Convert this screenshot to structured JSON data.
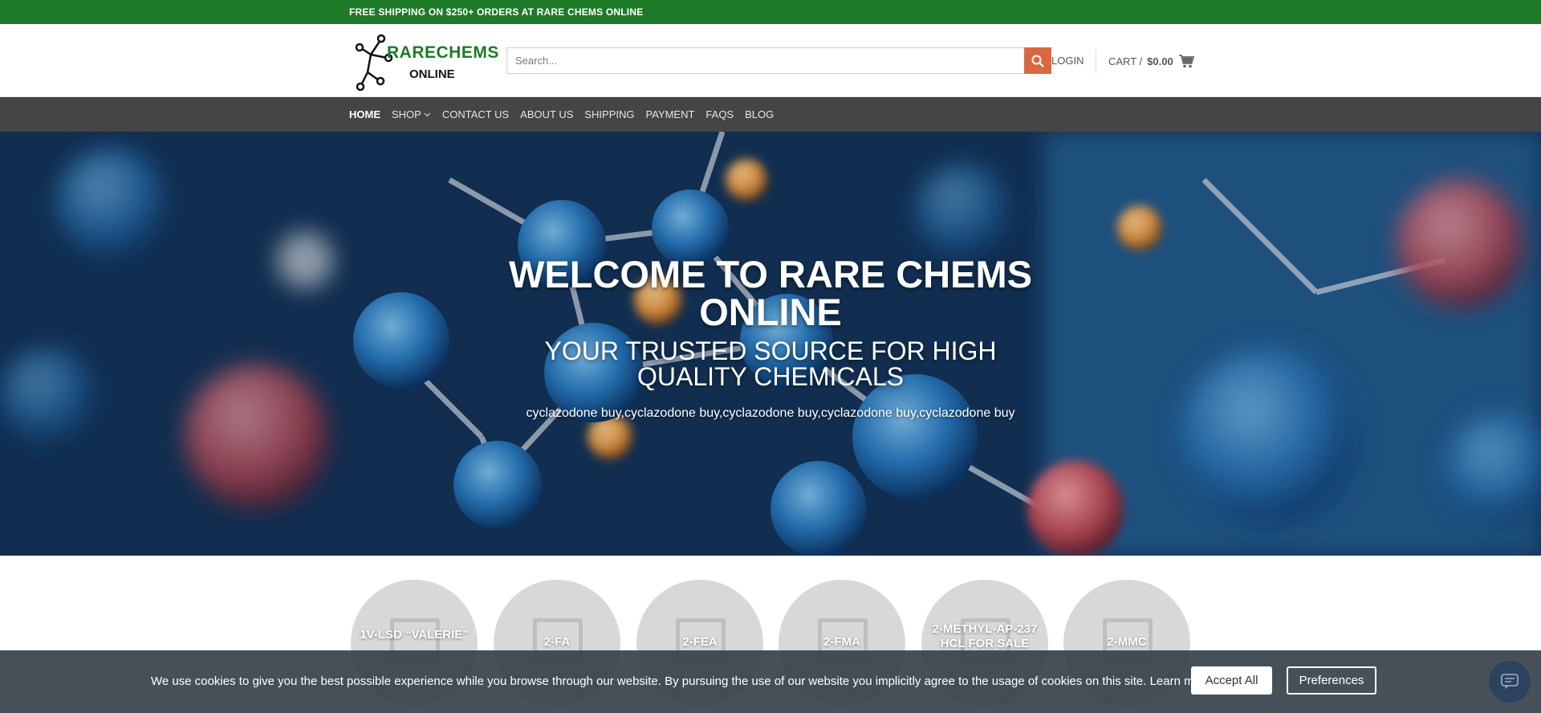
{
  "topbar": {
    "text": "FREE SHIPPING ON $250+ ORDERS AT RARE CHEMS ONLINE"
  },
  "header": {
    "logo_line1": "RARECHEMS",
    "logo_line2": "ONLINE",
    "search_placeholder": "Search...",
    "login": "LOGIN",
    "cart_label": "CART /",
    "cart_amount": "$0.00"
  },
  "nav": {
    "items": [
      {
        "label": "HOME"
      },
      {
        "label": "SHOP"
      },
      {
        "label": "CONTACT US"
      },
      {
        "label": "ABOUT US"
      },
      {
        "label": "SHIPPING"
      },
      {
        "label": "PAYMENT"
      },
      {
        "label": "FAQS"
      },
      {
        "label": "BLOG"
      }
    ]
  },
  "hero": {
    "title": "WELCOME TO  RARE CHEMS ONLINE",
    "subtitle": "YOUR TRUSTED SOURCE FOR HIGH QUALITY CHEMICALS",
    "tagline": "cyclazodone buy,cyclazodone buy,cyclazodone buy,cyclazodone buy,cyclazodone buy"
  },
  "categories": [
    {
      "label": "1V-LSD “VALERIE”"
    },
    {
      "label": "2-FA"
    },
    {
      "label": "2-FEA"
    },
    {
      "label": "2-FMA"
    },
    {
      "label": "2-METHYL-AP-237 HCL FOR SALE"
    },
    {
      "label": "2-MMC"
    }
  ],
  "cookie": {
    "message": "We use cookies to give you the best possible experience while you browse through our website. By pursuing the use of our website you implicitly agree to the usage of cookies on this site.",
    "learn_more": "Learn more",
    "accept": "Accept All",
    "preferences": "Preferences"
  },
  "colors": {
    "brand_green": "#1d7a27",
    "nav_bg": "#454545",
    "search_button": "#d9683f"
  }
}
